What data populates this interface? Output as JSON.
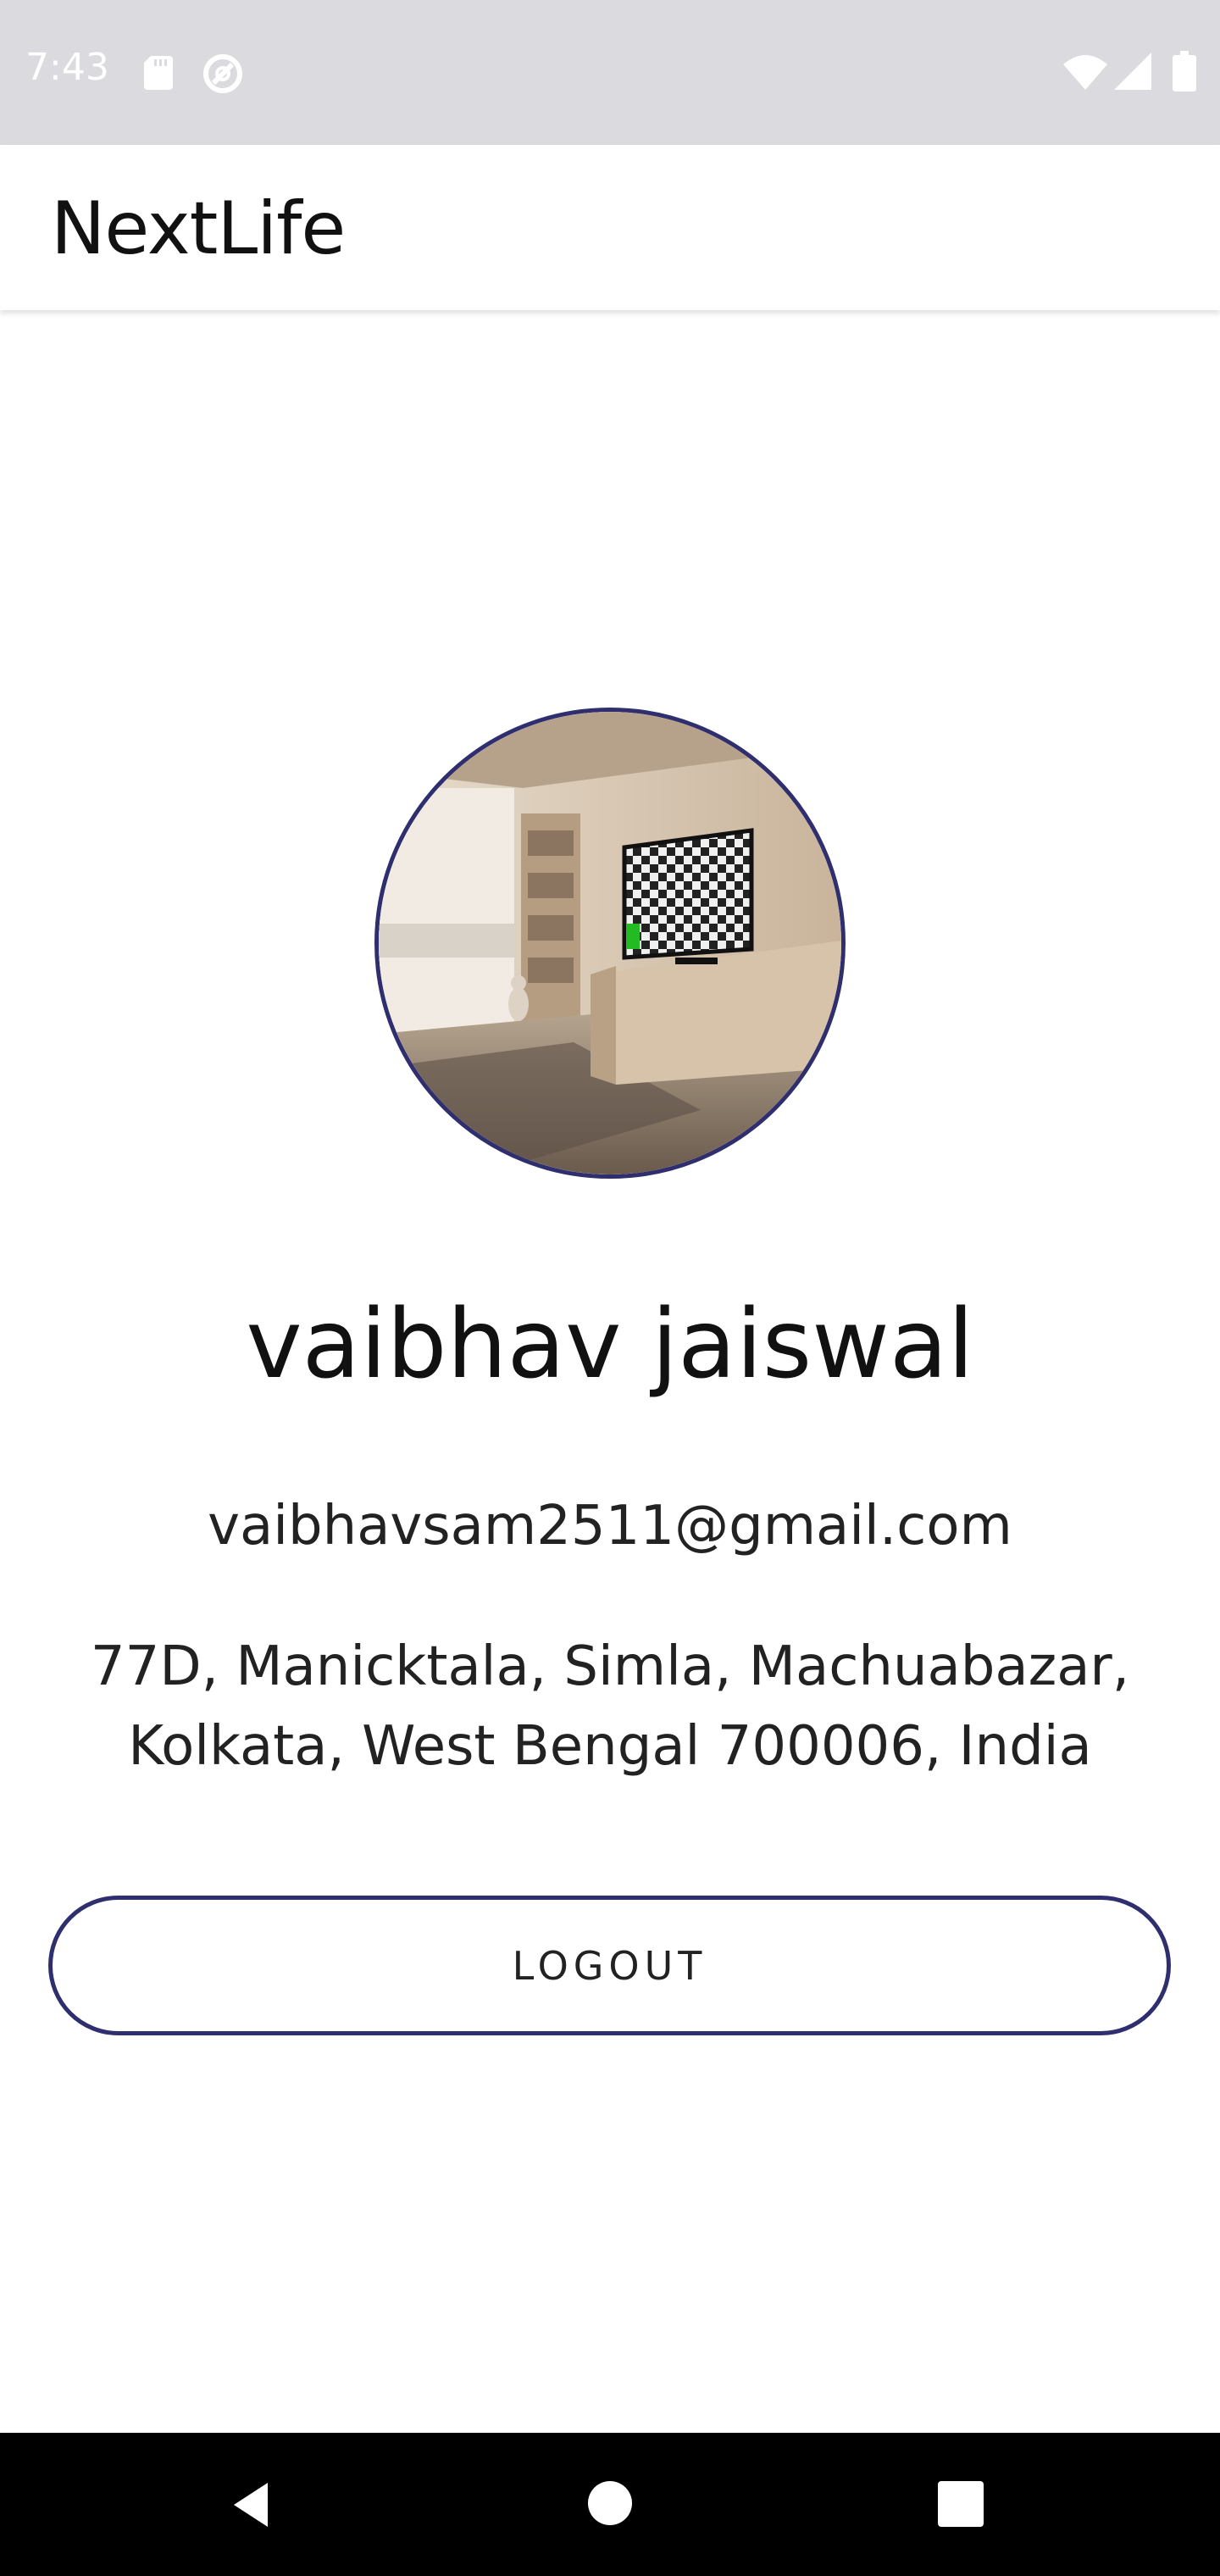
{
  "status_bar": {
    "time": "7:43",
    "icons": [
      "sd-card-icon",
      "sync-icon",
      "wifi-icon",
      "cell-signal-icon",
      "battery-icon"
    ]
  },
  "app_bar": {
    "title": "NextLife"
  },
  "profile": {
    "avatar_icon": "profile-photo",
    "name": "vaibhav jaiswal",
    "email": "vaibhavsam2511@gmail.com",
    "address_line1": "77D, Manicktala, Simla, Machuabazar,",
    "address_line2": "Kolkata, West Bengal 700006, India"
  },
  "actions": {
    "logout_label": "LOGOUT"
  },
  "nav_bar": {
    "icons": [
      "back-icon",
      "home-icon",
      "recents-icon"
    ]
  },
  "colors": {
    "accent": "#2f2e6e",
    "status_bar_bg": "#dadadf",
    "nav_bar_bg": "#000000"
  }
}
